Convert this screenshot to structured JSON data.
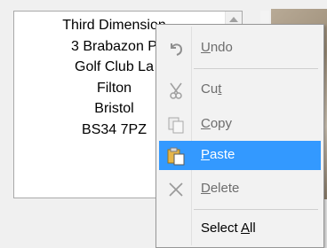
{
  "address": {
    "lines": [
      "Third Dimension",
      "3 Brabazon P",
      "Golf Club La",
      "Filton",
      "Bristol",
      "BS34 7PZ"
    ]
  },
  "menu": {
    "undo": {
      "pre": "",
      "key": "U",
      "post": "ndo"
    },
    "cut": {
      "pre": "Cu",
      "key": "t",
      "post": ""
    },
    "copy": {
      "pre": "",
      "key": "C",
      "post": "opy"
    },
    "paste": {
      "pre": "",
      "key": "P",
      "post": "aste"
    },
    "delete": {
      "pre": "",
      "key": "D",
      "post": "elete"
    },
    "select_all": {
      "pre": "Select ",
      "key": "A",
      "post": "ll"
    }
  },
  "colors": {
    "highlight": "#3399ff",
    "disabled_text": "#6d6d6d"
  }
}
